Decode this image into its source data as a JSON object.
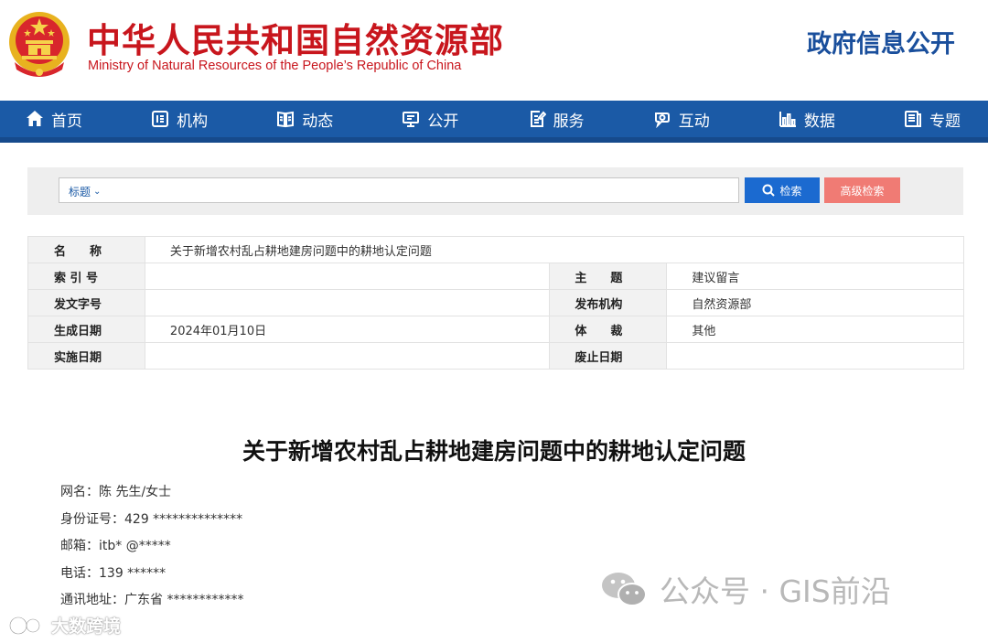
{
  "header": {
    "site_title": "中华人民共和国自然资源部",
    "site_subtitle": "Ministry of Natural Resources of the People’s Republic of China",
    "section_title": "政府信息公开",
    "emblem_icon": "national-emblem-icon"
  },
  "nav": {
    "items": [
      {
        "label": "首页",
        "icon": "home-icon"
      },
      {
        "label": "机构",
        "icon": "organization-icon"
      },
      {
        "label": "动态",
        "icon": "book-icon"
      },
      {
        "label": "公开",
        "icon": "monitor-icon"
      },
      {
        "label": "服务",
        "icon": "document-edit-icon"
      },
      {
        "label": "互动",
        "icon": "chat-icon"
      },
      {
        "label": "数据",
        "icon": "bar-chart-icon"
      },
      {
        "label": "专题",
        "icon": "topic-icon"
      }
    ],
    "background": "#1b5aa6"
  },
  "search": {
    "type_label": "标题",
    "input_value": "",
    "search_button": "检索",
    "advanced_button": "高级检索"
  },
  "info": {
    "name_label": "名　　称",
    "name_value": "关于新增农村乱占耕地建房问题中的耕地认定问题",
    "index_label": "索 引 号",
    "index_value": "",
    "topic_label": "主　　题",
    "topic_value": "建议留言",
    "doc_no_label": "发文字号",
    "doc_no_value": "",
    "publisher_label": "发布机构",
    "publisher_value": "自然资源部",
    "date_label": "生成日期",
    "date_value": "2024年01月10日",
    "genre_label": "体　　裁",
    "genre_value": "其他",
    "effective_label": "实施日期",
    "effective_value": "",
    "abolish_label": "废止日期",
    "abolish_value": ""
  },
  "article": {
    "title": "关于新增农村乱占耕地建房问题中的耕地认定问题",
    "lines": [
      "网名：陈 先生/女士",
      "身份证号：429 **************",
      "邮箱：itb* @*****",
      "电话：139 ******",
      "通讯地址：广东省 ************"
    ]
  },
  "watermarks": {
    "gis": "公众号 · GIS前沿",
    "dsj": "大数跨境"
  },
  "colors": {
    "brand_red": "#c8161d",
    "brand_blue": "#1a4f9c",
    "search_blue": "#1b6ad0",
    "advanced_red": "#f07b74"
  }
}
